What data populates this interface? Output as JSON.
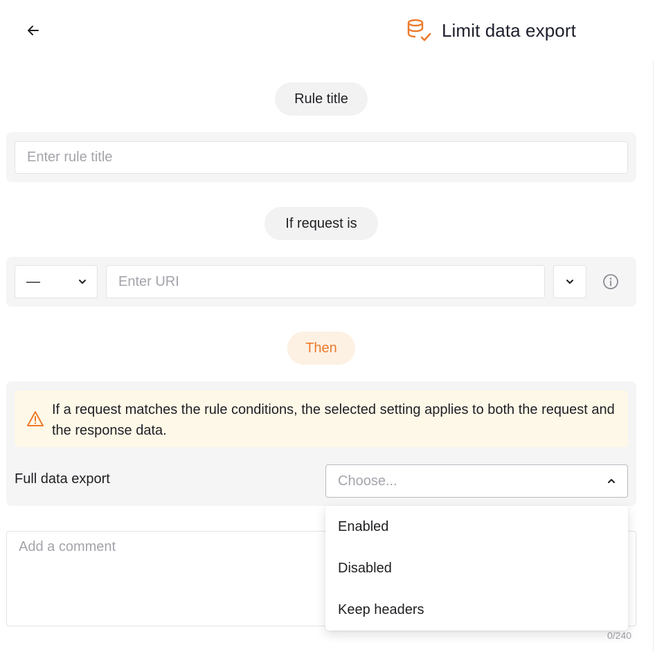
{
  "header": {
    "back_icon": "arrow-left-icon",
    "title_icon": "database-check-icon",
    "title": "Limit data export"
  },
  "colors": {
    "accent": "#ec7a2c",
    "panel_bg": "#f5f5f6",
    "warning_bg": "#fef8e8",
    "then_pill_bg": "#fdf1e4"
  },
  "rule_title_section": {
    "pill_label": "Rule title",
    "input_placeholder": "Enter rule title",
    "input_value": ""
  },
  "condition_section": {
    "pill_label": "If request is",
    "method_value": "—",
    "uri_placeholder": "Enter URI",
    "uri_value": "",
    "info_icon": "info-circle-icon"
  },
  "then_section": {
    "pill_label": "Then",
    "warning_icon": "warning-triangle-icon",
    "warning_text": "If a request matches the rule conditions, the selected setting applies to both the request and the response data.",
    "export_label": "Full data export",
    "export_placeholder": "Choose...",
    "export_options": [
      "Enabled",
      "Disabled",
      "Keep headers"
    ]
  },
  "comment": {
    "placeholder": "Add a comment",
    "counter": "0/240"
  }
}
